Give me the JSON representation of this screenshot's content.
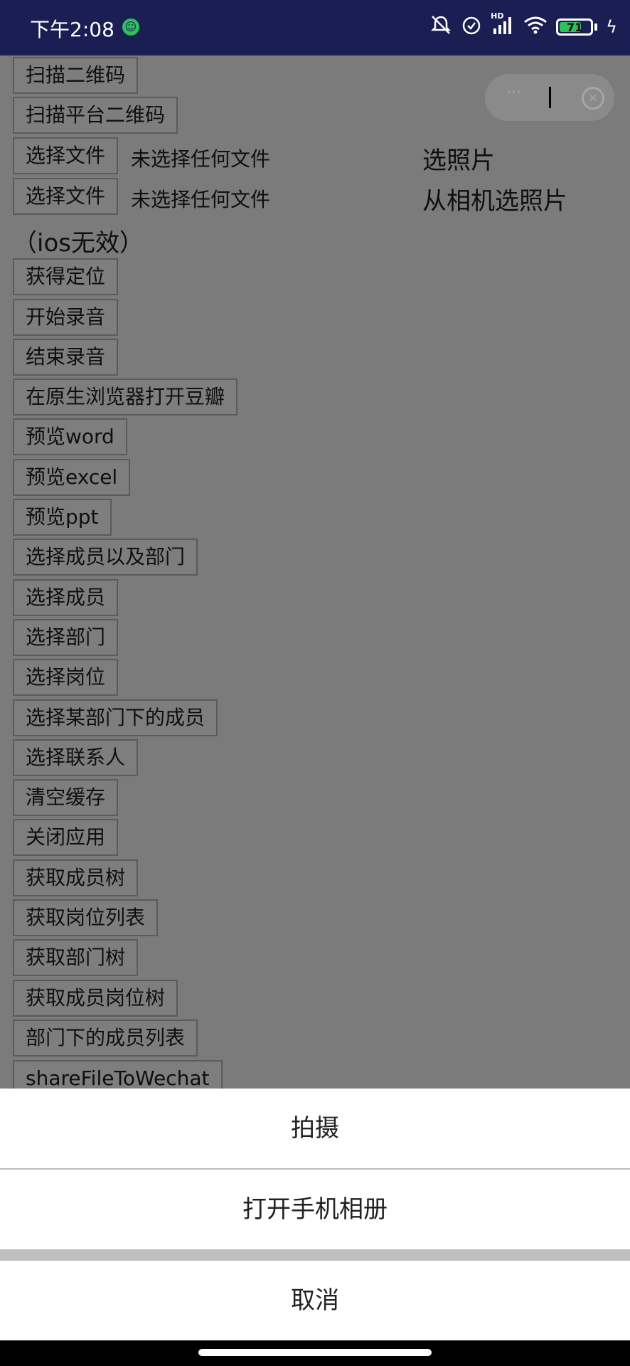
{
  "status_bar": {
    "time": "下午2:08",
    "notification_icon": "wechat-work-icon",
    "icons": [
      "mute-icon",
      "alarm-icon",
      "signal-icon",
      "wifi-icon"
    ],
    "network_badge": "HD",
    "battery_level": "71",
    "battery_fraction": 0.71,
    "charging_icon": "lightning-icon"
  },
  "page": {
    "buttons": {
      "scan_qr": "扫描二维码",
      "scan_platform_qr": "扫描平台二维码",
      "choose_file_1": "选择文件",
      "choose_file_2": "选择文件",
      "get_location": "获得定位",
      "start_record": "开始录音",
      "stop_record": "结束录音",
      "open_douban": "在原生浏览器打开豆瓣",
      "preview_word": "预览word",
      "preview_excel": "预览excel",
      "preview_ppt": "预览ppt",
      "select_members_depts": "选择成员以及部门",
      "select_members": "选择成员",
      "select_depts": "选择部门",
      "select_posts": "选择岗位",
      "select_dept_members": "选择某部门下的成员",
      "select_contacts": "选择联系人",
      "clear_cache": "清空缓存",
      "close_app": "关闭应用",
      "get_member_tree": "获取成员树",
      "get_post_list": "获取岗位列表",
      "get_dept_tree": "获取部门树",
      "get_member_post_tree": "获取成员岗位树",
      "dept_member_list": "部门下的成员列表",
      "share_wechat": "shareFileToWechat"
    },
    "file_status_1": "未选择任何文件",
    "file_status_2": "未选择任何文件",
    "choose_photo": "选照片",
    "choose_from_camera": "从相机选照片",
    "ios_note": "（ios无效）"
  },
  "capsule": {
    "more_icon": "more-dots-icon",
    "more_text": "···",
    "close_icon": "close-circle-icon",
    "close_text": "×"
  },
  "action_sheet": {
    "take_photo": "拍摄",
    "open_album": "打开手机相册",
    "cancel": "取消"
  },
  "colors": {
    "status_bar_bg": "#1a1e52",
    "overlay_bg": "#7b7b7b",
    "sheet_bg": "#ffffff",
    "battery_green": "#2fbf5b"
  }
}
